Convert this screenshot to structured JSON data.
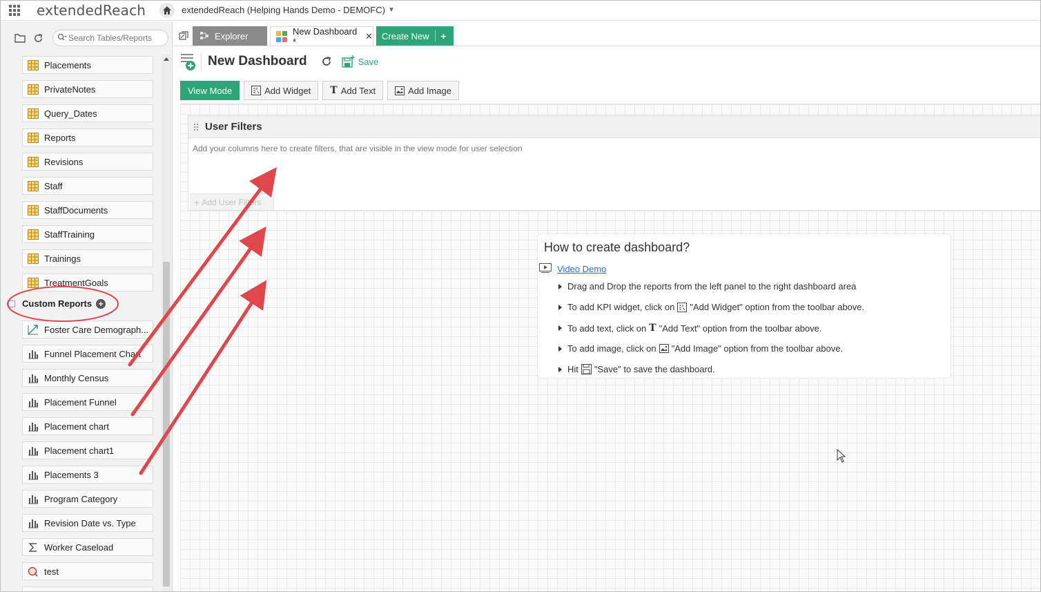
{
  "app": {
    "brand": "extendedReach",
    "workspace": "extendedReach (Helping Hands Demo - DEMOFC)"
  },
  "sidebar": {
    "search_placeholder": "Search Tables/Reports",
    "tables": [
      {
        "label": "Placements"
      },
      {
        "label": "PrivateNotes"
      },
      {
        "label": "Query_Dates"
      },
      {
        "label": "Reports"
      },
      {
        "label": "Revisions"
      },
      {
        "label": "Staff"
      },
      {
        "label": "StaffDocuments"
      },
      {
        "label": "StaffTraining"
      },
      {
        "label": "Trainings"
      },
      {
        "label": "TreatmentGoals"
      }
    ],
    "section_title": "Custom Reports",
    "reports": [
      {
        "label": "Foster Care Demograph...",
        "icon": "scatter-chart-icon"
      },
      {
        "label": "Funnel Placement Chart",
        "icon": "bar-chart-icon"
      },
      {
        "label": "Monthly Census",
        "icon": "bar-chart-icon"
      },
      {
        "label": "Placement Funnel",
        "icon": "bar-chart-icon"
      },
      {
        "label": "Placement chart",
        "icon": "bar-chart-icon"
      },
      {
        "label": "Placement chart1",
        "icon": "bar-chart-icon"
      },
      {
        "label": "Placements 3",
        "icon": "bar-chart-icon"
      },
      {
        "label": "Program Category",
        "icon": "bar-chart-icon"
      },
      {
        "label": "Revision Date vs. Type",
        "icon": "bar-chart-icon"
      },
      {
        "label": "Worker Caseload",
        "icon": "sigma-icon"
      },
      {
        "label": "test",
        "icon": "query-icon"
      }
    ]
  },
  "tabs": {
    "explorer": "Explorer",
    "dashboard": "New Dashboard *",
    "create_new": "Create New"
  },
  "header": {
    "title": "New Dashboard",
    "save": "Save"
  },
  "toolbar": {
    "view_mode": "View Mode",
    "add_widget": "Add Widget",
    "add_text": "Add Text",
    "add_image": "Add Image"
  },
  "filters": {
    "title": "User Filters",
    "hint": "Add your columns here to create filters, that are visible in the view mode for user selection",
    "add": "Add User Filters"
  },
  "howto": {
    "title": "How to create dashboard?",
    "video": "Video Demo",
    "step1": "Drag and Drop the reports from the left panel to the right dashboard area",
    "step2_pre": "To add KPI widget, click on",
    "step2_post": "\"Add Widget\" option from the toolbar above.",
    "step3_pre": "To add text, click on",
    "step3_post": "\"Add Text\" option from the toolbar above.",
    "step4_pre": "To add image, click on",
    "step4_post": "\"Add Image\" option from the toolbar above.",
    "step5_pre": "Hit",
    "step5_post": "\"Save\" to save the dashboard."
  },
  "colors": {
    "accent": "#2da579",
    "annotation": "#e0474c",
    "link": "#2b6fd6"
  }
}
